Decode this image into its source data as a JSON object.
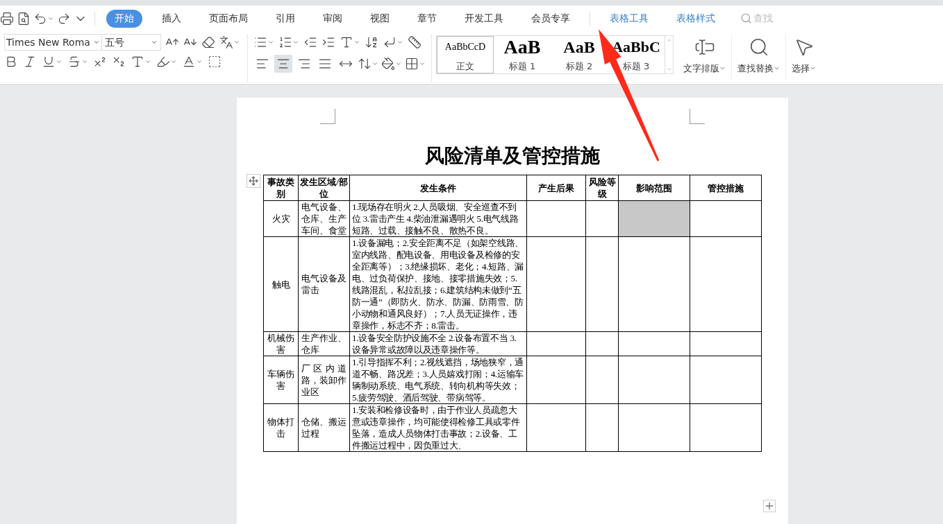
{
  "menu_tabs": [
    {
      "label": "开始",
      "kind": "main",
      "selected": true
    },
    {
      "label": "插入",
      "kind": "main",
      "selected": false
    },
    {
      "label": "页面布局",
      "kind": "main",
      "selected": false
    },
    {
      "label": "引用",
      "kind": "main",
      "selected": false
    },
    {
      "label": "审阅",
      "kind": "main",
      "selected": false
    },
    {
      "label": "视图",
      "kind": "main",
      "selected": false
    },
    {
      "label": "章节",
      "kind": "main",
      "selected": false
    },
    {
      "label": "开发工具",
      "kind": "main",
      "selected": false
    },
    {
      "label": "会员专享",
      "kind": "main",
      "selected": false
    },
    {
      "label": "表格工具",
      "kind": "context",
      "selected": false
    },
    {
      "label": "表格样式",
      "kind": "context",
      "selected": false
    }
  ],
  "search": {
    "placeholder": "查找"
  },
  "font": {
    "name": "Times New Roma",
    "size": "五号"
  },
  "align_buttons": [
    {
      "selected": false
    },
    {
      "selected": true
    },
    {
      "selected": false
    },
    {
      "selected": false
    },
    {
      "selected": false
    }
  ],
  "styles": [
    {
      "preview": "AaBbCcD",
      "label": "正文",
      "kind": "body",
      "selected": true
    },
    {
      "preview": "AaB",
      "label": "标题 1",
      "kind": "h1",
      "selected": false
    },
    {
      "preview": "AaB",
      "label": "标题 2",
      "kind": "h2",
      "selected": false
    },
    {
      "preview": "AaBbC",
      "label": "标题 3",
      "kind": "h3",
      "selected": false
    }
  ],
  "big_buttons": [
    {
      "label": "文字排版",
      "kind": "layout"
    },
    {
      "label": "查找替换",
      "kind": "find"
    },
    {
      "label": "选择",
      "kind": "select"
    }
  ],
  "document": {
    "title": "风险清单及管控措施",
    "table": {
      "columns": [
        "事故类别",
        "发生区域/部位",
        "发生条件",
        "产生后果",
        "风险等级",
        "影响范围",
        "管控措施"
      ],
      "rows": [
        {
          "cells": [
            "火灾",
            "电气设备、仓库、生产车间、食堂",
            "1.现场存在明火 2.人员吸烟、安全巡查不到位 3.雷击产生 4.柴油泄漏遇明火 5.电气线路短路、过载、接触不良、散热不良。"
          ],
          "empty_cells": [
            {
              "selected": false
            },
            {
              "selected": false
            },
            {
              "selected": true
            },
            {
              "selected": false
            }
          ]
        },
        {
          "cells": [
            "触电",
            "电气设备及雷击",
            "1.设备漏电；2.安全距离不足（如架空线路、室内线路、配电设备、用电设备及检修的安全距离等）；3.绝缘损坏、老化；4.短路、漏电、过负荷保护、接地、接零措施失效；5.线路混乱，私拉乱接；6.建筑结构未做到“五防一通”（即防火、防水、防漏、防雨雪、防小动物和通风良好）；7.人员无证操作，违章操作，标志不齐；8.雷击。"
          ],
          "empty_cells": [
            {
              "selected": false
            },
            {
              "selected": false
            },
            {
              "selected": false
            },
            {
              "selected": false
            }
          ]
        },
        {
          "cells": [
            "机械伤害",
            "生产作业、仓库",
            "1.设备安全防护设施不全 2.设备布置不当 3.设备异常或故障以及违章操作等。"
          ],
          "empty_cells": [
            {
              "selected": false
            },
            {
              "selected": false
            },
            {
              "selected": false
            },
            {
              "selected": false
            }
          ]
        },
        {
          "cells": [
            "车辆伤害",
            "厂区内道路，装卸作业区",
            "1.引导指挥不利；2.视线遮挡，场地狭窄，通道不畅、路况差；3.人员嬉戏打闹；4.运输车辆制动系统、电气系统、转向机构等失效；5.疲劳驾驶、酒后驾驶、带病驾等。"
          ],
          "empty_cells": [
            {
              "selected": false
            },
            {
              "selected": false
            },
            {
              "selected": false
            },
            {
              "selected": false
            }
          ]
        },
        {
          "cells": [
            "物体打击",
            "仓储、搬运过程",
            "1.安装和检修设备时，由于作业人员疏忽大意或违章操作，均可能使得检修工具或零件坠落，造成人员物体打击事故；2.设备、工件搬运过程中，因负重过大、"
          ],
          "empty_cells": [
            {
              "selected": false
            },
            {
              "selected": false
            },
            {
              "selected": false
            },
            {
              "selected": false
            }
          ]
        }
      ]
    }
  }
}
